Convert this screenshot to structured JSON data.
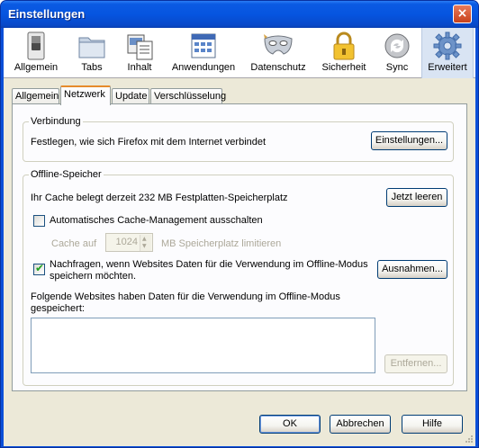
{
  "window": {
    "title": "Einstellungen",
    "close_label": "×"
  },
  "toolbar": {
    "panes": [
      {
        "label": "Allgemein",
        "icon": "switch-icon"
      },
      {
        "label": "Tabs",
        "icon": "tabs-folder-icon"
      },
      {
        "label": "Inhalt",
        "icon": "content-icon"
      },
      {
        "label": "Anwendungen",
        "icon": "applications-icon"
      },
      {
        "label": "Datenschutz",
        "icon": "mask-icon"
      },
      {
        "label": "Sicherheit",
        "icon": "lock-icon"
      },
      {
        "label": "Sync",
        "icon": "sync-icon"
      },
      {
        "label": "Erweitert",
        "icon": "gear-icon"
      }
    ],
    "selected": "Erweitert"
  },
  "tabs": [
    "Allgemein",
    "Netzwerk",
    "Update",
    "Verschlüsselung"
  ],
  "active_tab": "Netzwerk",
  "connection": {
    "title": "Verbindung",
    "description": "Festlegen, wie sich Firefox mit dem Internet verbindet",
    "button_label": "Einstellungen..."
  },
  "offline": {
    "title": "Offline-Speicher",
    "cache_text": "Ihr Cache belegt derzeit 232 MB Festplatten-Speicherplatz",
    "clear_button": "Jetzt leeren",
    "auto_cache_label": "Automatisches Cache-Management ausschalten",
    "auto_cache_checked": false,
    "cache_limit_label": "Cache auf",
    "cache_limit_value": "1024",
    "cache_limit_suffix": "MB Speicherplatz limitieren",
    "ask_line1": "Nachfragen, wenn Websites Daten für die Verwendung im Offline-Modus",
    "ask_line2": "speichern möchten.",
    "ask_checked": true,
    "exceptions_button": "Ausnahmen...",
    "sites_label_line1": "Folgende Websites haben Daten für die Verwendung im Offline-Modus",
    "sites_label_line2": "gespeichert:",
    "remove_button": "Entfernen..."
  },
  "footer": {
    "ok": "OK",
    "cancel": "Abbrechen",
    "help": "Hilfe"
  }
}
